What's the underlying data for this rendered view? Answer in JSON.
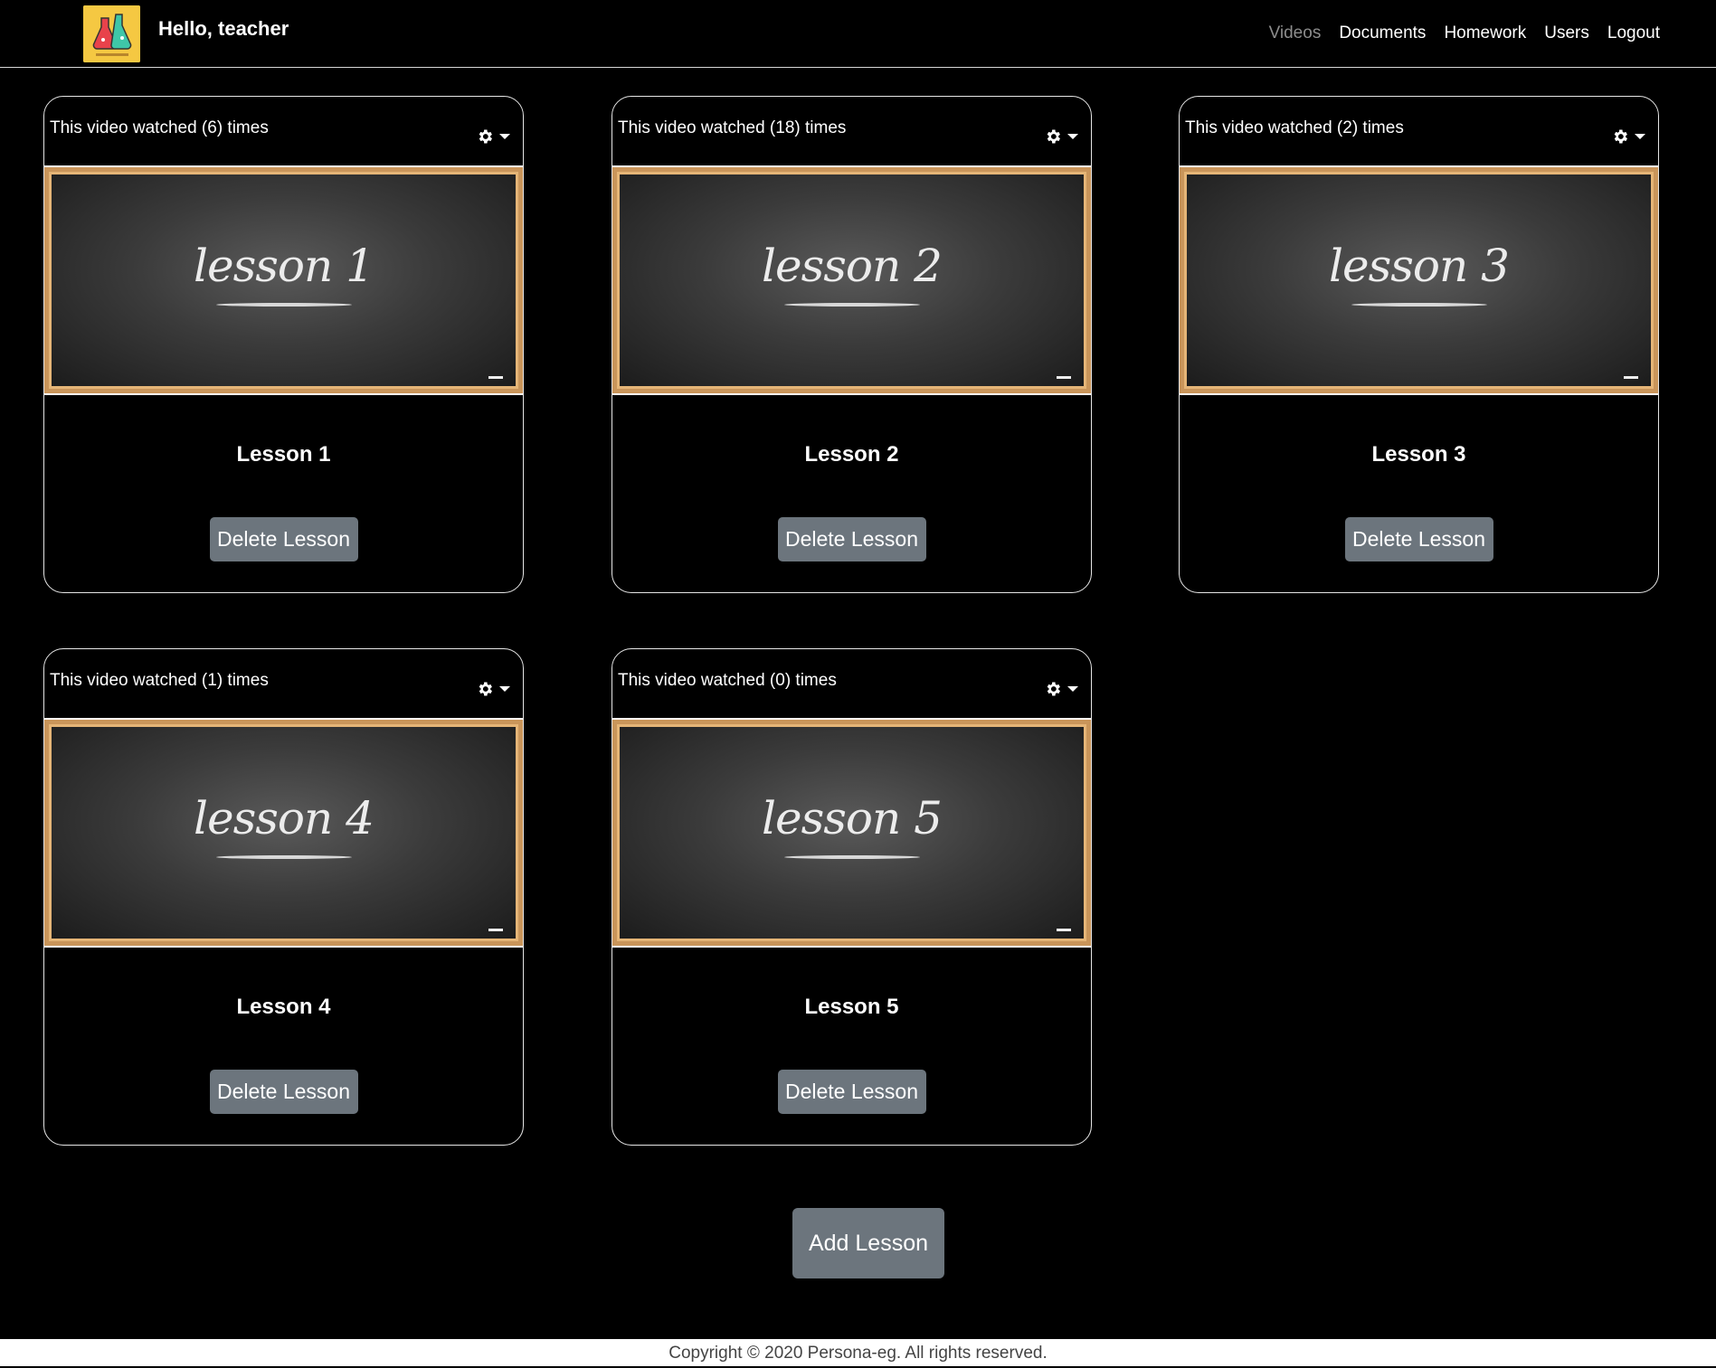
{
  "navbar": {
    "greeting": "Hello, teacher",
    "links": [
      "Videos",
      "Documents",
      "Homework",
      "Users",
      "Logout"
    ],
    "active_link": "Videos"
  },
  "cards": [
    {
      "watch_text": "This video watched (6) times",
      "thumb_text": "lesson 1",
      "title": "Lesson 1",
      "delete_label": "Delete Lesson"
    },
    {
      "watch_text": "This video watched (18) times",
      "thumb_text": "lesson 2",
      "title": "Lesson 2",
      "delete_label": "Delete Lesson"
    },
    {
      "watch_text": "This video watched (2) times",
      "thumb_text": "lesson 3",
      "title": "Lesson 3",
      "delete_label": "Delete Lesson"
    },
    {
      "watch_text": "This video watched (1) times",
      "thumb_text": "lesson 4",
      "title": "Lesson 4",
      "delete_label": "Delete Lesson"
    },
    {
      "watch_text": "This video watched (0) times",
      "thumb_text": "lesson 5",
      "title": "Lesson 5",
      "delete_label": "Delete Lesson"
    }
  ],
  "add_lesson_label": "Add Lesson",
  "footer": {
    "text": "Copyright © 2020 Persona-eg. All rights reserved."
  },
  "colors": {
    "background": "#000000",
    "button": "#6c757d",
    "logo_bg": "#f5c842",
    "nav_active": "#8c8c8c",
    "frame": "#e5b577"
  },
  "icons": {
    "settings": "gear-icon",
    "dropdown": "caret-down-icon"
  }
}
